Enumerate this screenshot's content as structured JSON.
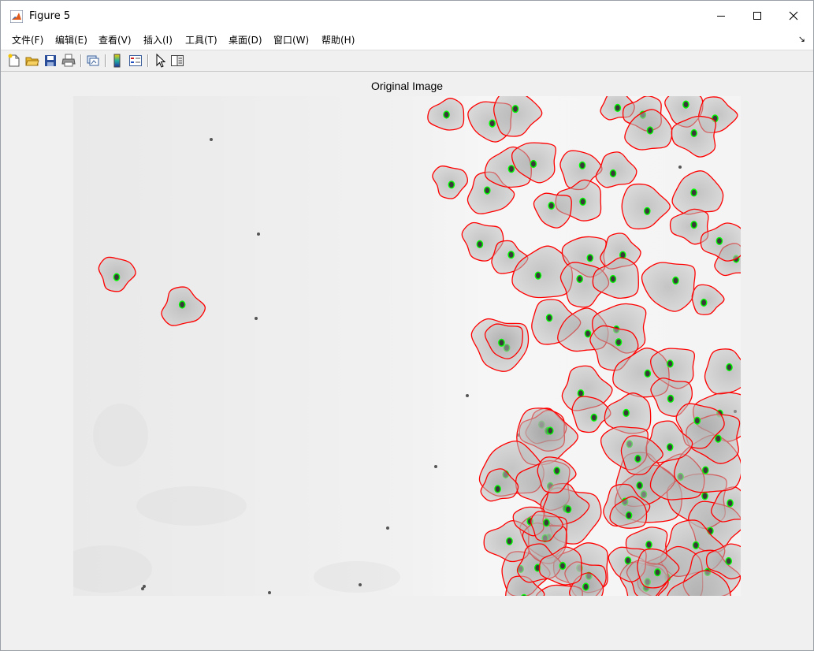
{
  "window": {
    "title": "Figure 5"
  },
  "menu": [
    {
      "label": "文件(F)"
    },
    {
      "label": "编辑(E)"
    },
    {
      "label": "查看(V)"
    },
    {
      "label": "插入(I)"
    },
    {
      "label": "工具(T)"
    },
    {
      "label": "桌面(D)"
    },
    {
      "label": "窗口(W)"
    },
    {
      "label": "帮助(H)"
    }
  ],
  "toolbar": [
    {
      "icon": "new-figure-icon"
    },
    {
      "icon": "open-file-icon"
    },
    {
      "icon": "save-icon"
    },
    {
      "icon": "print-icon"
    },
    {
      "icon": "link-plot-icon"
    },
    {
      "icon": "insert-colorbar-icon"
    },
    {
      "icon": "insert-legend-icon"
    },
    {
      "icon": "edit-plot-icon"
    },
    {
      "icon": "property-inspector-icon"
    }
  ],
  "axes": {
    "title": "Original Image"
  },
  "colors": {
    "cell_outline": "#ff0000",
    "nucleus_outline": "#00ff00",
    "background": "#f0f0f0"
  }
}
